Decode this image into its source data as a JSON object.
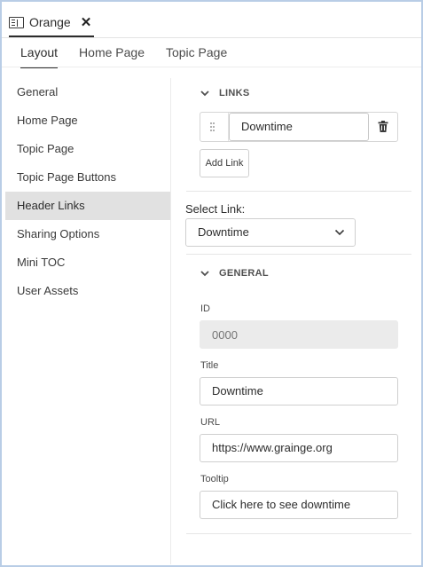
{
  "document_tab": {
    "title": "Orange",
    "close_glyph": "✕",
    "icon": "document-icon"
  },
  "tabs": [
    {
      "label": "Layout",
      "active": true
    },
    {
      "label": "Home Page",
      "active": false
    },
    {
      "label": "Topic Page",
      "active": false
    }
  ],
  "sidebar": {
    "items": [
      {
        "label": "General",
        "selected": false
      },
      {
        "label": "Home Page",
        "selected": false
      },
      {
        "label": "Topic Page",
        "selected": false
      },
      {
        "label": "Topic Page Buttons",
        "selected": false
      },
      {
        "label": "Header Links",
        "selected": true
      },
      {
        "label": "Sharing Options",
        "selected": false
      },
      {
        "label": "Mini TOC",
        "selected": false
      },
      {
        "label": "User Assets",
        "selected": false
      }
    ]
  },
  "links_section": {
    "title": "LINKS",
    "items": [
      {
        "value": "Downtime"
      }
    ],
    "add_button_label": "Add Link"
  },
  "select_link": {
    "label": "Select Link:",
    "value": "Downtime"
  },
  "general_section": {
    "title": "GENERAL",
    "id": {
      "label": "ID",
      "placeholder": "0000",
      "value": ""
    },
    "title_field": {
      "label": "Title",
      "value": "Downtime"
    },
    "url": {
      "label": "URL",
      "value": "https://www.grainge.org"
    },
    "tooltip": {
      "label": "Tooltip",
      "value": "Click here to see downtime"
    }
  },
  "colors": {
    "frame_border": "#b9cde6",
    "selected_item_bg": "#e1e1e1",
    "disabled_field_bg": "#ebebeb",
    "text": "#2c2c2c"
  }
}
